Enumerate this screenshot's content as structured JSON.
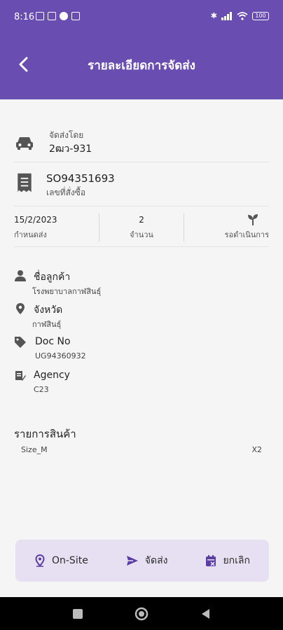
{
  "status_bar": {
    "time": "8:16",
    "battery": "100"
  },
  "app_bar": {
    "title": "รายละเอียดการจัดส่ง"
  },
  "delivery": {
    "label": "จัดส่งโดย",
    "value": "2ฒว-931"
  },
  "order": {
    "number": "SO94351693",
    "label": "เลขที่สั่งซื้อ"
  },
  "summary": {
    "date_value": "15/2/2023",
    "date_label": "กำหนดส่ง",
    "qty_value": "2",
    "qty_label": "จำนวน",
    "status_label": "รอดำเนินการ"
  },
  "customer": {
    "label": "ชื่อลูกค้า",
    "value": "โรงพยาบาลกาฬสินธุ์"
  },
  "province": {
    "label": "จังหวัด",
    "value": "กาฬสินธุ์"
  },
  "doc": {
    "label": "Doc No",
    "value": "UG94360932"
  },
  "agency": {
    "label": "Agency",
    "value": "C23"
  },
  "products": {
    "title": "รายการสินค้า",
    "items": [
      {
        "name": "Size_M",
        "qty": "X2"
      }
    ]
  },
  "actions": {
    "onsite": "On-Site",
    "ship": "จัดส่ง",
    "cancel": "ยกเลิก"
  }
}
